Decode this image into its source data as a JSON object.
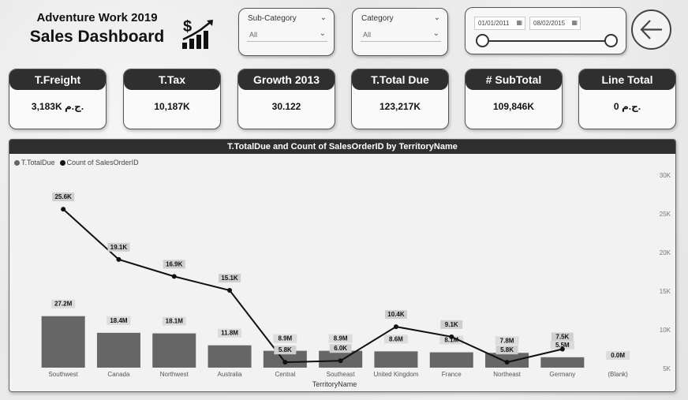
{
  "header": {
    "subtitle": "Adventure Work 2019",
    "title": "Sales Dashboard",
    "icon": "money-growth-icon"
  },
  "slicers": {
    "subcategory": {
      "label": "Sub-Category",
      "value": "All"
    },
    "category": {
      "label": "Category",
      "value": "All"
    },
    "date": {
      "start": "01/01/2011",
      "end": "08/02/2015"
    }
  },
  "back_button": {
    "icon": "back-arrow-icon"
  },
  "kpis": [
    {
      "title": "T.Freight",
      "value": "3,183K ج.م."
    },
    {
      "title": "T.Tax",
      "value": "10,187K"
    },
    {
      "title": "Growth 2013",
      "value": "30.122"
    },
    {
      "title": "T.Total Due",
      "value": "123,217K"
    },
    {
      "title": "# SubTotal",
      "value": "109,846K"
    },
    {
      "title": "Line Total",
      "value": "0 ج.م."
    }
  ],
  "chart": {
    "title": "T.TotalDue and Count of SalesOrderID by TerritoryName",
    "xlabel": "TerritoryName",
    "colors": {
      "bar": "#666666",
      "line": "#111111"
    }
  },
  "chart_data": {
    "type": "bar",
    "title": "T.TotalDue and Count of SalesOrderID by TerritoryName",
    "xlabel": "TerritoryName",
    "categories": [
      "Southwest",
      "Canada",
      "Northwest",
      "Australia",
      "Central",
      "Southeast",
      "United Kingdom",
      "France",
      "Northeast",
      "Germany",
      "(Blank)"
    ],
    "series": [
      {
        "name": "T.TotalDue",
        "type": "bar",
        "values": [
          27.2,
          18.4,
          18.1,
          11.8,
          8.9,
          8.9,
          8.6,
          8.1,
          7.8,
          5.5,
          0.0
        ],
        "labels": [
          "27.2M",
          "18.4M",
          "18.1M",
          "11.8M",
          "8.9M",
          "8.9M",
          "8.6M",
          "8.1M",
          "7.8M",
          "5.5M",
          "0.0M"
        ]
      },
      {
        "name": "Count of SalesOrderID",
        "type": "line",
        "values": [
          25.6,
          19.1,
          16.9,
          15.1,
          5.8,
          6.0,
          10.4,
          9.1,
          5.8,
          7.5,
          null
        ],
        "labels": [
          "25.6K",
          "19.1K",
          "16.9K",
          "15.1K",
          "5.8K",
          "6.0K",
          "10.4K",
          "9.1K",
          "5.8K",
          "7.5K",
          ""
        ]
      }
    ],
    "y2_ticks": [
      "30K",
      "25K",
      "20K",
      "15K",
      "10K",
      "5K"
    ],
    "y2lim": [
      5,
      30
    ],
    "legend": "top-left"
  }
}
